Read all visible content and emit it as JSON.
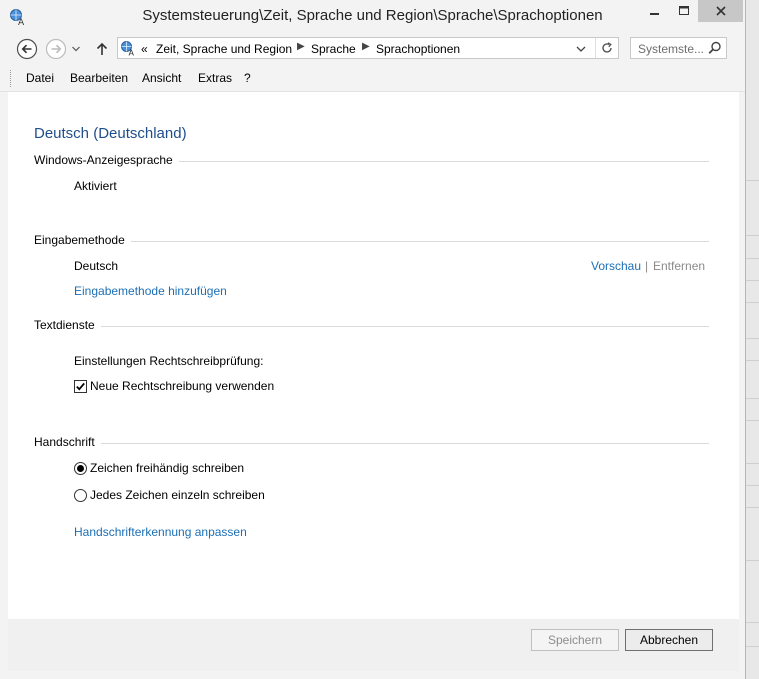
{
  "window": {
    "title": "Systemsteuerung\\Zeit, Sprache und Region\\Sprache\\Sprachoptionen"
  },
  "address": {
    "overflow": "«",
    "crumbs": [
      "Zeit, Sprache und Region",
      "Sprache",
      "Sprachoptionen"
    ],
    "search_placeholder": "Systemste..."
  },
  "menu": [
    "Datei",
    "Bearbeiten",
    "Ansicht",
    "Extras",
    "?"
  ],
  "main": {
    "heading": "Deutsch (Deutschland)",
    "display_language": {
      "label": "Windows-Anzeigesprache",
      "status": "Aktiviert"
    },
    "input_method": {
      "label": "Eingabemethode",
      "name": "Deutsch",
      "preview_link": "Vorschau",
      "separator": "|",
      "remove_link": "Entfernen",
      "add_link": "Eingabemethode hinzufügen"
    },
    "text_services": {
      "label": "Textdienste",
      "spell_label": "Einstellungen Rechtschreibprüfung:",
      "new_spelling": {
        "label": "Neue Rechtschreibung verwenden",
        "checked": true
      }
    },
    "handwriting": {
      "label": "Handschrift",
      "options": [
        {
          "label": "Zeichen freihändig schreiben",
          "selected": true
        },
        {
          "label": "Jedes Zeichen einzeln schreiben",
          "selected": false
        }
      ],
      "customize_link": "Handschrifterkennung anpassen"
    }
  },
  "buttons": {
    "save": "Speichern",
    "cancel": "Abbrechen"
  },
  "colors": {
    "heading": "#1e4e8c",
    "link": "#1c6fb5",
    "disabled": "#8a8a8a"
  }
}
